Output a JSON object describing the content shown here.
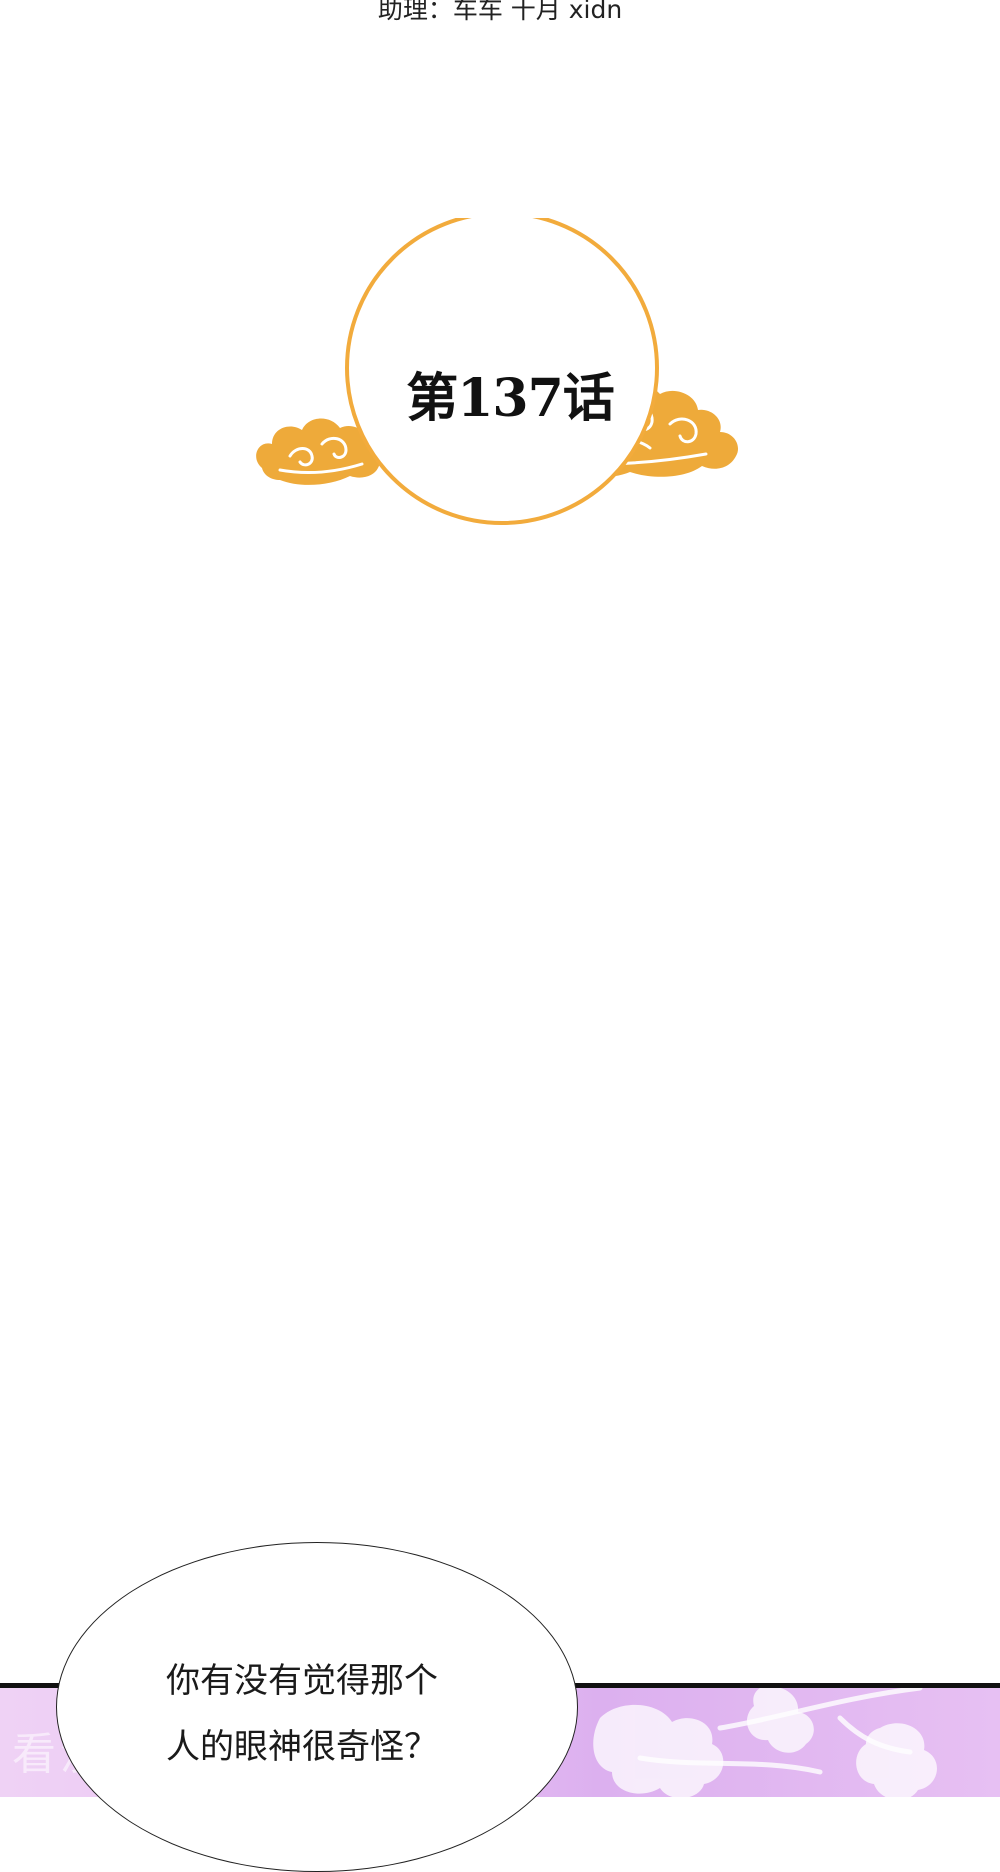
{
  "credits": {
    "text": "助理：车车 十月 xidn"
  },
  "chapter": {
    "title": "第137话"
  },
  "dialogue": {
    "line1": "你有没有觉得那个",
    "line2": "人的眼神很奇怪？"
  },
  "watermark": {
    "text": "看漫"
  },
  "colors": {
    "ring": "#f2ab3c",
    "cloud": "#eeaa3a",
    "band": "#e6bff3"
  }
}
